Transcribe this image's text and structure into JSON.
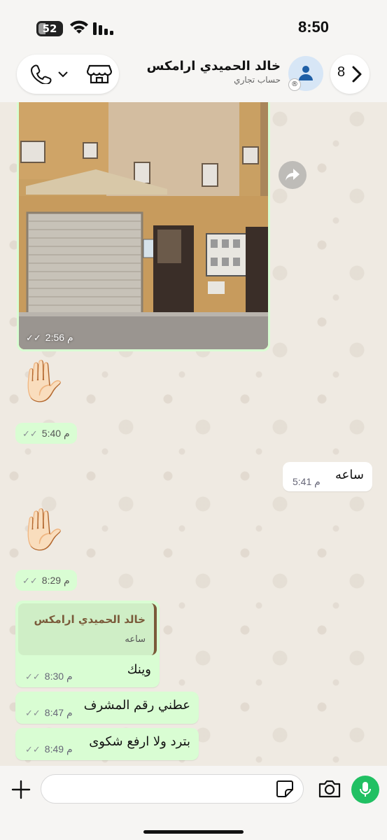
{
  "status_bar": {
    "time": "8:50",
    "battery": "52"
  },
  "header": {
    "contact_name": "خالد الحميدي ارامكس",
    "contact_subtitle": "حساب تجاري",
    "unread_count": "8",
    "icons": {
      "call": "phone-icon",
      "store": "store-icon",
      "back": "chevron-right-icon",
      "avatar": "person-icon"
    }
  },
  "messages": [
    {
      "type": "image",
      "direction": "outgoing",
      "time": "2:56 م",
      "status": "read"
    },
    {
      "type": "emoji",
      "direction": "outgoing",
      "emoji": "✋🏻",
      "time": "5:40 م",
      "status": "read"
    },
    {
      "type": "text",
      "direction": "incoming",
      "text": "ساعه",
      "time": "5:41 م"
    },
    {
      "type": "emoji",
      "direction": "outgoing",
      "emoji": "✋🏻",
      "time": "8:29 م",
      "status": "read"
    },
    {
      "type": "text",
      "direction": "outgoing",
      "quote": {
        "author": "خالد الحميدي ارامكس",
        "text": "ساعه"
      },
      "text": "وينك",
      "time": "8:30 م",
      "status": "read"
    },
    {
      "type": "text",
      "direction": "outgoing",
      "text": "عطني رقم المشرف",
      "time": "8:47 م",
      "status": "read"
    },
    {
      "type": "text",
      "direction": "outgoing",
      "text": "بترد ولا ارفع شكوى",
      "time": "8:49 م",
      "status": "read"
    }
  ],
  "composer": {
    "placeholder": "",
    "icons": {
      "attach": "plus-icon",
      "sticker": "sticker-icon",
      "camera": "camera-icon",
      "mic": "microphone-icon"
    }
  },
  "colors": {
    "outgoing_bubble": "#d9fdd3",
    "incoming_bubble": "#ffffff",
    "mic_button": "#21c063",
    "quote_author": "#7a5a3a"
  }
}
